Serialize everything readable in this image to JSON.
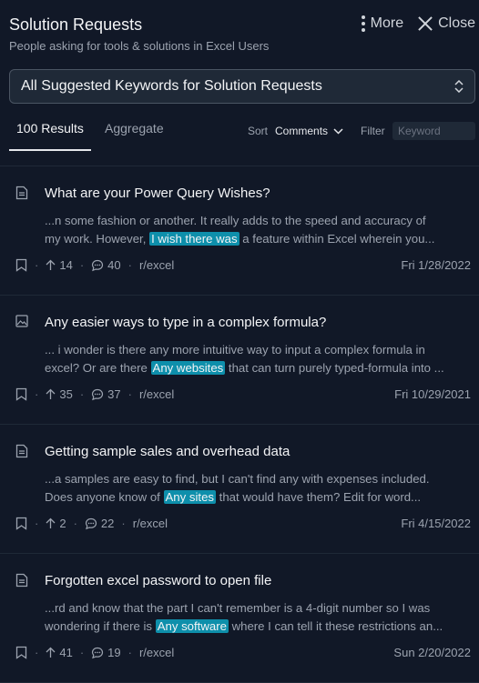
{
  "header": {
    "title": "Solution Requests",
    "subtitle": "People asking for tools & solutions in Excel Users",
    "more_label": "More",
    "close_label": "Close"
  },
  "keyword_select": {
    "value": "All Suggested Keywords for Solution Requests"
  },
  "tabs": [
    {
      "label": "100 Results",
      "active": true
    },
    {
      "label": "Aggregate",
      "active": false
    }
  ],
  "sort": {
    "label": "Sort",
    "value": "Comments"
  },
  "filter": {
    "label": "Filter",
    "placeholder": "Keyword"
  },
  "results": [
    {
      "icon": "document-icon",
      "title": "What are your Power Query Wishes?",
      "line1": "...n some fashion or another. It really adds to the speed and accuracy of",
      "line2_before": "my work. However, ",
      "highlight": "I wish there was",
      "line2_after": " a feature within Excel wherein you...",
      "upvotes": "14",
      "comments": "40",
      "subreddit": "r/excel",
      "date": "Fri 1/28/2022"
    },
    {
      "icon": "image-icon",
      "title": "Any easier ways to type in a complex formula?",
      "line1": "... i wonder is there any more intuitive way to input a complex formula in",
      "line2_before": "excel? Or are there ",
      "highlight": "Any websites",
      "line2_after": " that can turn purely typed-formula into ...",
      "upvotes": "35",
      "comments": "37",
      "subreddit": "r/excel",
      "date": "Fri 10/29/2021"
    },
    {
      "icon": "document-icon",
      "title": "Getting sample sales and overhead data",
      "line1": "...a samples are easy to find, but I can't find any with expenses included.",
      "line2_before": "Does anyone know of ",
      "highlight": "Any sites",
      "line2_after": " that would have them? Edit for word...",
      "upvotes": "2",
      "comments": "22",
      "subreddit": "r/excel",
      "date": "Fri 4/15/2022"
    },
    {
      "icon": "document-icon",
      "title": "Forgotten excel password to open file",
      "line1": "...rd and know that the part I can't remember is a 4-digit number so I was",
      "line2_before": "wondering if there is ",
      "highlight": "Any software",
      "line2_after": " where I can tell it these restrictions an...",
      "upvotes": "41",
      "comments": "19",
      "subreddit": "r/excel",
      "date": "Sun 2/20/2022"
    }
  ],
  "colors": {
    "background": "#111827",
    "highlight": "#0e8fab"
  }
}
